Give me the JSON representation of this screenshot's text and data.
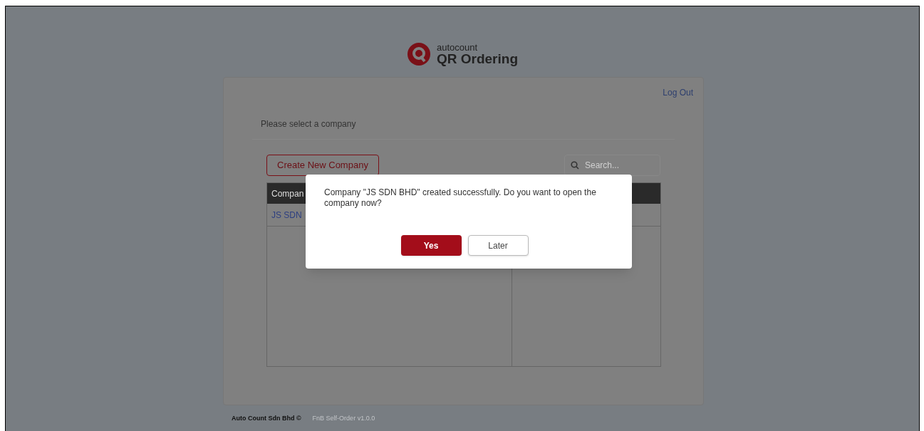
{
  "logo": {
    "brand": "autocount",
    "product": "QR Ordering"
  },
  "header": {
    "logout": "Log Out"
  },
  "prompt": "Please select a company",
  "toolbar": {
    "create_button": "Create New Company",
    "search": {
      "placeholder": "Search..."
    }
  },
  "table": {
    "columns": [
      "Compan"
    ],
    "rows": [
      [
        "JS SDN"
      ]
    ]
  },
  "dialog": {
    "message": "Company \"JS SDN BHD\" created successfully. Do you want to open the company now?",
    "buttons": [
      {
        "label": "Yes",
        "kind": "primary"
      },
      {
        "label": "Later",
        "kind": "secondary"
      }
    ]
  },
  "footer": {
    "company": "Auto Count Sdn Bhd ©",
    "version": "FnB Self-Order v1.0.0"
  }
}
